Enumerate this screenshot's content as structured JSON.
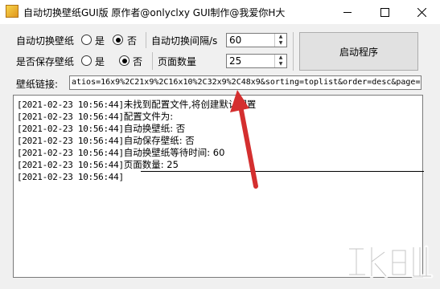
{
  "window": {
    "title": "自动切换壁纸GUI版 原作者@onlyclxy GUI制作@我爱你H大"
  },
  "settings": {
    "auto_switch_label": "自动切换壁纸",
    "auto_switch_yes": "是",
    "auto_switch_no": "否",
    "auto_switch_selected": "否",
    "interval_label": "自动切换间隔/s",
    "interval_value": "60",
    "save_label": "是否保存壁纸",
    "save_yes": "是",
    "save_no": "否",
    "save_selected": "否",
    "pages_label": "页面数量",
    "pages_value": "25",
    "start_button": "启动程序"
  },
  "url": {
    "label": "壁纸链接:",
    "value": "atios=16x9%2C21x9%2C16x10%2C32x9%2C48x9&sorting=toplist&order=desc&page="
  },
  "log": {
    "lines": [
      {
        "ts": "[2021-02-23 10:56:44]",
        "msg": "未找到配置文件,将创建默认配置"
      },
      {
        "ts": "[2021-02-23 10:56:44]",
        "msg": "配置文件为:"
      },
      {
        "ts": "[2021-02-23 10:56:44]",
        "msg": "自动换壁纸: 否"
      },
      {
        "ts": "[2021-02-23 10:56:44]",
        "msg": "自动保存壁纸: 否"
      },
      {
        "ts": "[2021-02-23 10:56:44]",
        "msg": "自动换壁纸等待时间: 60"
      },
      {
        "ts": "[2021-02-23 10:56:44]",
        "msg": "页面数量: 25"
      },
      {
        "ts": "[2021-02-23 10:56:44]",
        "msg": ""
      }
    ]
  },
  "colors": {
    "arrow": "#d42f2f",
    "window_bg": "#f0f0f0"
  },
  "icons": {
    "app": "app-icon",
    "minimize": "minimize-icon",
    "maximize": "maximize-icon",
    "close": "close-icon"
  }
}
